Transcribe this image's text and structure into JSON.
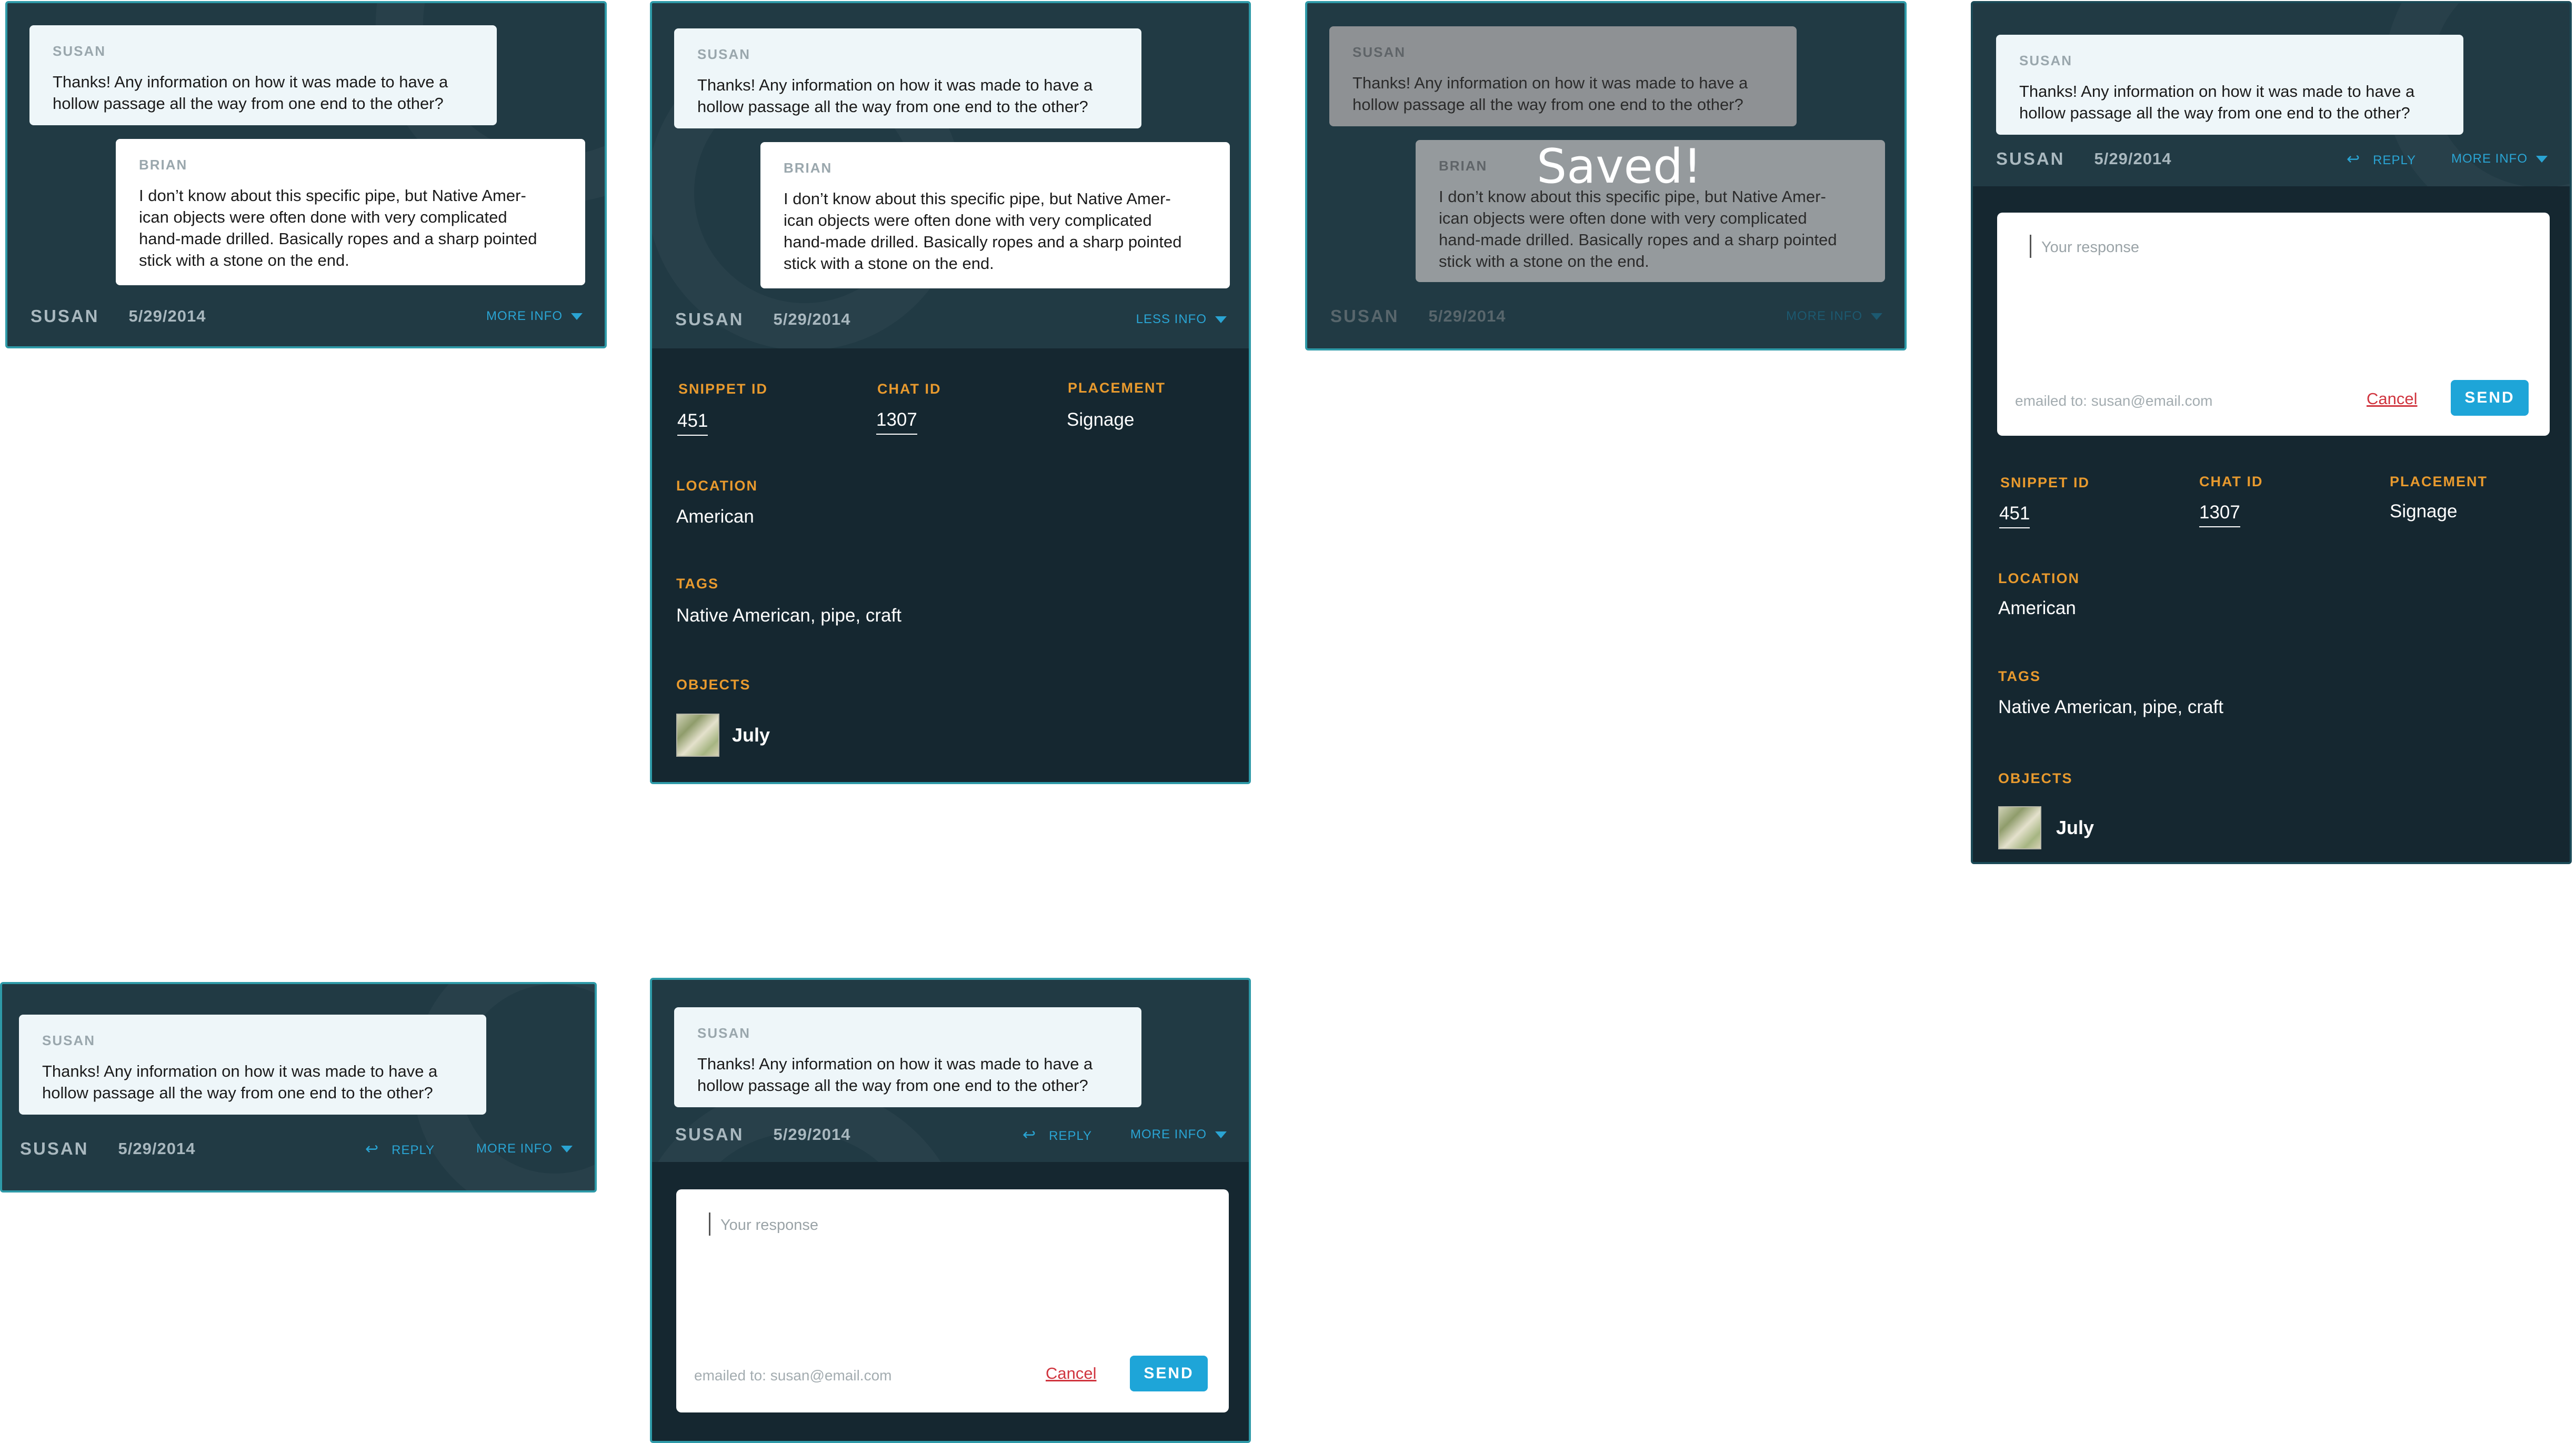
{
  "thread": {
    "question": {
      "sender": "SUSAN",
      "text_line1": "Thanks! Any information on how it was made to have a",
      "text_line2": "hollow passage all the way from one end to the other?"
    },
    "answer": {
      "sender": "BRIAN",
      "text_line1": "I don’t know about this specific pipe, but Native Amer-",
      "text_line2": "ican objects were often done with very complicated",
      "text_line3": "hand-made drilled. Basically ropes and a sharp pointed",
      "text_line4": "stick with a stone on the end."
    }
  },
  "footer": {
    "name": "SUSAN",
    "date": "5/29/2014",
    "more_info": "MORE INFO",
    "less_info": "LESS INFO",
    "reply": "REPLY"
  },
  "details": {
    "snippet_id_label": "SNIPPET ID",
    "snippet_id": "451",
    "chat_id_label": "CHAT ID",
    "chat_id": "1307",
    "placement_label": "PLACEMENT",
    "placement": "Signage",
    "location_label": "LOCATION",
    "location": "American",
    "tags_label": "TAGS",
    "tags": "Native American, pipe, craft",
    "objects_label": "OBJECTS",
    "object_name": "July"
  },
  "reply_form": {
    "placeholder": "Your response",
    "emailed_to": "emailed to: susan@email.com",
    "cancel": "Cancel",
    "send": "SEND"
  },
  "saved_message": "Saved!",
  "icons": {
    "dropdown": "triangle-down-icon",
    "reply": "reply-arrow-icon",
    "object_thumbnail": "object-thumbnail"
  },
  "colors": {
    "card_bg": "#213a44",
    "card_border": "#2e9aa8",
    "details_bg": "#152730",
    "label_orange": "#e89a2e",
    "link_blue": "#2aa4d3",
    "send_blue": "#1ea5d8",
    "cancel_red": "#d0343e"
  }
}
